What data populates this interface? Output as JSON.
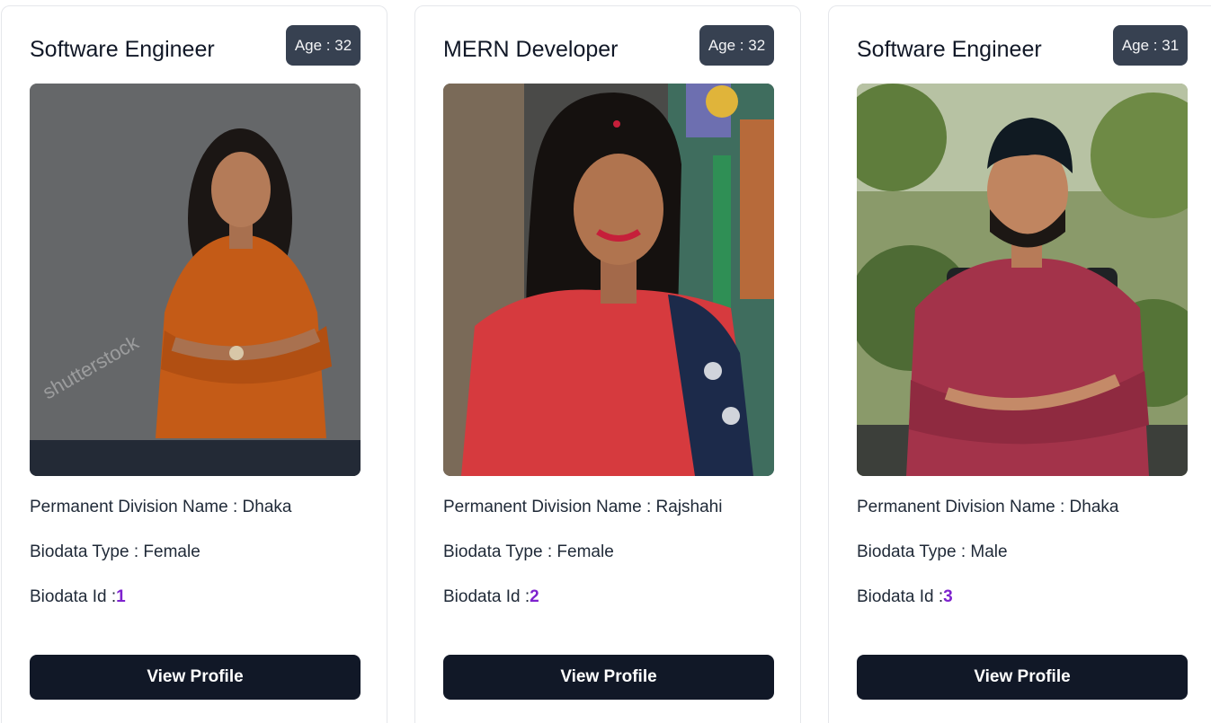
{
  "cards": [
    {
      "title": "Software Engineer",
      "age_label": "Age : 32",
      "division_label": "Permanent Division Name : Dhaka",
      "type_label": "Biodata Type : Female",
      "id_prefix": "Biodata Id :",
      "id_value": "1",
      "button_label": "View Profile",
      "photo_watermark": "shutterstock"
    },
    {
      "title": "MERN Developer",
      "age_label": "Age : 32",
      "division_label": "Permanent Division Name : Rajshahi",
      "type_label": "Biodata Type : Female",
      "id_prefix": "Biodata Id :",
      "id_value": "2",
      "button_label": "View Profile"
    },
    {
      "title": "Software Engineer",
      "age_label": "Age : 31",
      "division_label": "Permanent Division Name : Dhaka",
      "type_label": "Biodata Type : Male",
      "id_prefix": "Biodata Id :",
      "id_value": "3",
      "button_label": "View Profile"
    }
  ],
  "colors": {
    "age_badge": "#374151",
    "button": "#111827",
    "id_accent": "#7e22ce"
  }
}
